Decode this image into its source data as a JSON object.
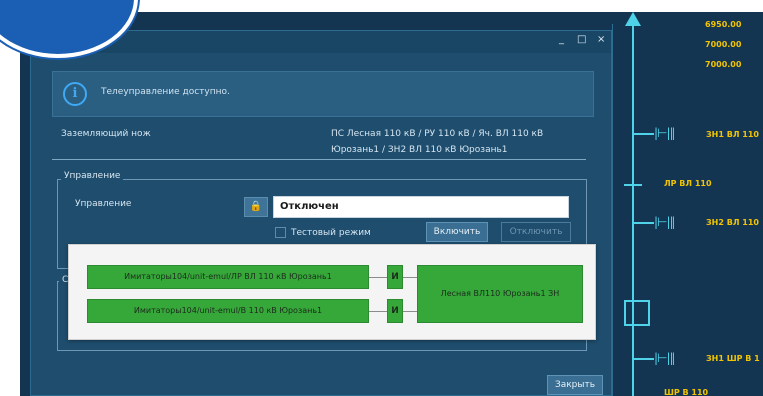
{
  "scheme": {
    "readouts": [
      "6950.00",
      "7000.00",
      "7000.00"
    ],
    "labels": {
      "zn1": "ЗН1 ВЛ 110",
      "lr": "ЛР ВЛ 110",
      "zn2": "ЗН2 ВЛ 110",
      "zn1_shr": "ЗН1 ШР В 1",
      "shr": "ШР В 110"
    }
  },
  "dialog": {
    "window_buttons": {
      "minimize": "_",
      "maximize": "□",
      "close": "×"
    },
    "info": {
      "icon": "info-icon",
      "text": "Телеуправление доступно."
    },
    "object_type": "Заземляющий нож",
    "object_path_line1": "ПС Лесная 110 кВ / РУ 110 кВ / Яч. ВЛ 110 кВ",
    "object_path_line2": "Юрозань1 / ЗН2 ВЛ 110 кВ Юрозань1",
    "control_group": {
      "title": "Управление",
      "row_label": "Управление",
      "lock_icon": "lock-icon",
      "state_value": "Отключен",
      "test_mode_label": "Тестовый режим",
      "test_mode_checked": false,
      "btn_on": "Включить",
      "btn_off": "Отключить"
    },
    "second_group_title_char": "С",
    "close_button": "Закрыть"
  },
  "interlock": {
    "conditions": [
      "Имитаторы104/unit-emul/ЛР ВЛ 110 кВ Юрозань1",
      "Имитаторы104/unit-emul/В 110 кВ Юрозань1"
    ],
    "operator": "И",
    "result": "Лесная ВЛ110 Юрозань1 ЗН"
  }
}
